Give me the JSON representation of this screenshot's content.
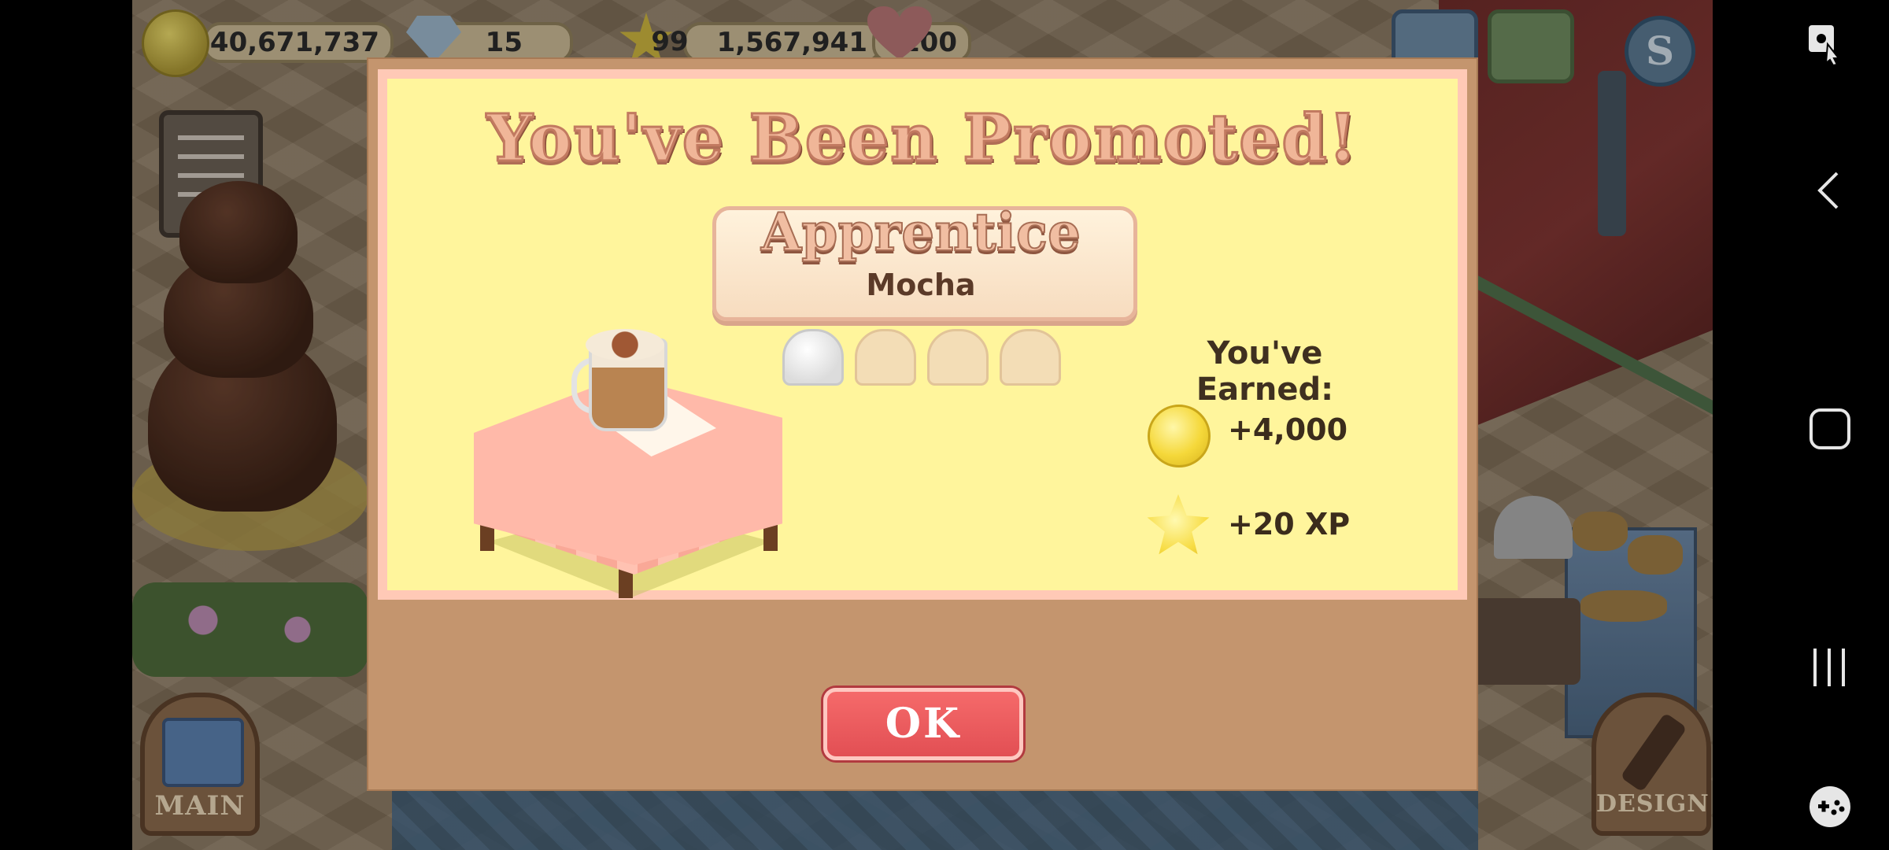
{
  "hud": {
    "coins": "40,671,737",
    "gems": "15",
    "level": "99",
    "xp": "1,567,941",
    "hearts": "100"
  },
  "corner_buttons": {
    "main_label": "MAIN",
    "design_label": "DESIGN"
  },
  "popup": {
    "title": "You've Been Promoted!",
    "rank": "Apprentice",
    "drink": "Mocha",
    "hats_earned": 1,
    "hats_total": 4,
    "earned_title": "You've Earned:",
    "rewards": [
      {
        "icon": "coin-icon",
        "text": "+4,000"
      },
      {
        "icon": "star-icon",
        "text": "+20 XP"
      }
    ],
    "ok_label": "OK"
  },
  "navbar": {
    "icons": [
      "screenshot-icon",
      "back-icon",
      "home-icon",
      "recents-icon",
      "game-tools-icon"
    ]
  },
  "colors": {
    "popup_panel": "#fff59c",
    "popup_frame": "#c4956e",
    "ok_button": "#e24f54"
  }
}
